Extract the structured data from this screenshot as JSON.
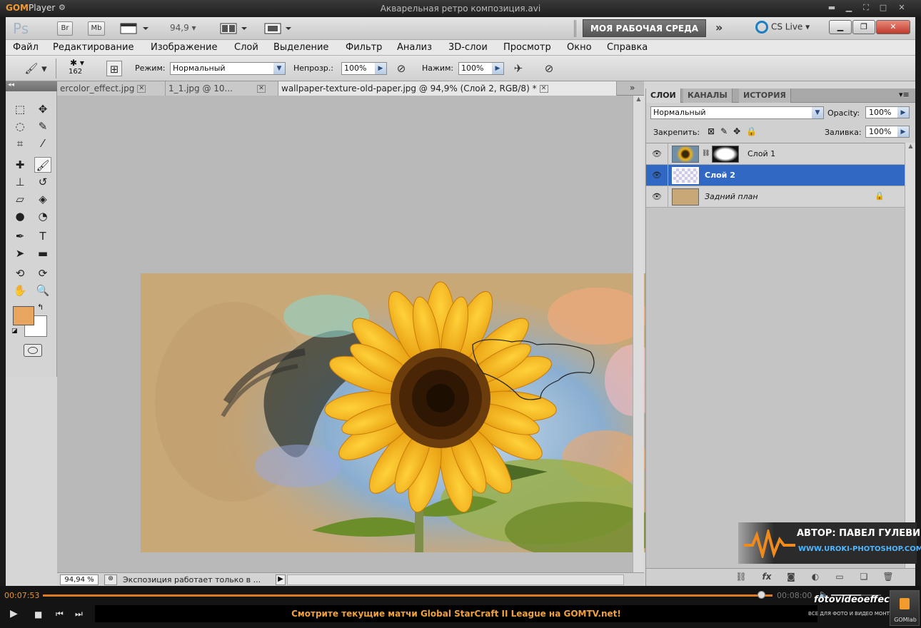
{
  "gom": {
    "logo_brand": "GOM",
    "logo_word": "Player",
    "filename": "Акварельная ретро композиция.avi",
    "elapsed": "00:07:53",
    "total": "00:08:00",
    "progress": 0.985,
    "ticker": "Смотрите текущие матчи Global StarCraft II League на GOMTV.net!",
    "gomlab_label": "GOMlab",
    "overlay_site": "fotovideoeffect.com",
    "overlay_tagline": "ВСЕ ДЛЯ ФОТО И ВИДЕО МОНТАЖА!"
  },
  "appbar": {
    "logo": "Ps",
    "bridge": "Br",
    "mini_bridge": "Mb",
    "zoom": "94,9",
    "workspace": "МОЯ РАБОЧАЯ СРЕДА",
    "more": "»",
    "cslive": "CS Live"
  },
  "menu": [
    "Файл",
    "Редактирование",
    "Изображение",
    "Слой",
    "Выделение",
    "Фильтр",
    "Анализ",
    "3D-слои",
    "Просмотр",
    "Окно",
    "Справка"
  ],
  "options": {
    "brush_size": "162",
    "mode_label": "Режим:",
    "mode_value": "Нормальный",
    "opacity_label": "Непрозр.:",
    "opacity_value": "100%",
    "pressure_label": "Нажим:",
    "pressure_value": "100%"
  },
  "tabs": [
    {
      "label": "ercolor_effect.jpg"
    },
    {
      "label": "1_1.jpg @ 10..."
    },
    {
      "label": "wallpaper-texture-old-paper.jpg @ 94,9% (Слой 2, RGB/8) *"
    }
  ],
  "status": {
    "zoom": "94,94 %",
    "text": "Экспозиция работает только в ..."
  },
  "colors": {
    "foreground": "#e8a55f",
    "background": "#ffffff",
    "selection": "#3168c4"
  },
  "layers_panel": {
    "tabs": [
      "СЛОИ",
      "КАНАЛЫ",
      "ИСТОРИЯ"
    ],
    "blend_mode": "Нормальный",
    "opacity_label": "Opacity:",
    "opacity_value": "100%",
    "lock_label": "Закрепить:",
    "fill_label": "Заливка:",
    "fill_value": "100%",
    "layers": [
      {
        "name": "Слой 1",
        "selected": false
      },
      {
        "name": "Слой 2",
        "selected": true
      },
      {
        "name": "Задний план",
        "selected": false,
        "locked": true
      }
    ]
  },
  "watermark": {
    "author": "АВТОР: ПАВЕЛ ГУЛЕВИЧ",
    "url": "WWW.UROKI-PHOTOSHOP.COM"
  }
}
